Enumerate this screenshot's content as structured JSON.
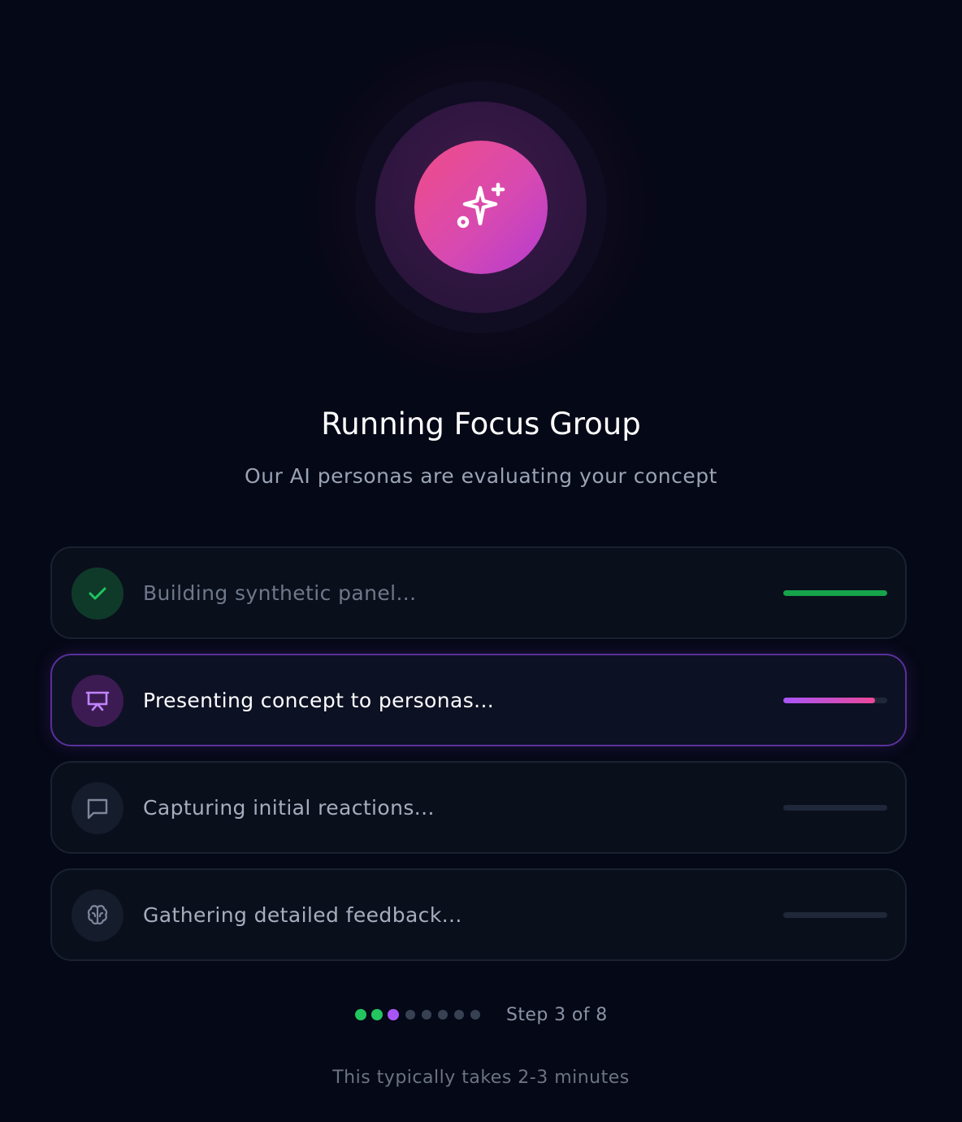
{
  "hero": {
    "icon": "sparkles-icon",
    "accent_colors": [
      "#f04c86",
      "#b43bd0"
    ]
  },
  "title": "Running Focus Group",
  "subtitle": "Our AI personas are evaluating your concept",
  "steps": [
    {
      "label": "Building synthetic panel...",
      "status": "done",
      "icon": "check-icon",
      "progress": 1.0
    },
    {
      "label": "Presenting concept to personas...",
      "status": "active",
      "icon": "presentation-icon",
      "progress": 0.88
    },
    {
      "label": "Capturing initial reactions...",
      "status": "pending",
      "icon": "chat-bubble-icon",
      "progress": 0
    },
    {
      "label": "Gathering detailed feedback...",
      "status": "pending",
      "icon": "brain-icon",
      "progress": 0
    }
  ],
  "progress": {
    "current_step": 3,
    "total_steps": 8,
    "label": "Step 3 of 8"
  },
  "footer_note": "This typically takes 2-3 minutes",
  "colors": {
    "background": "#050816",
    "done": "#22c55e",
    "active": "#a855f7",
    "pending": "#374151"
  }
}
